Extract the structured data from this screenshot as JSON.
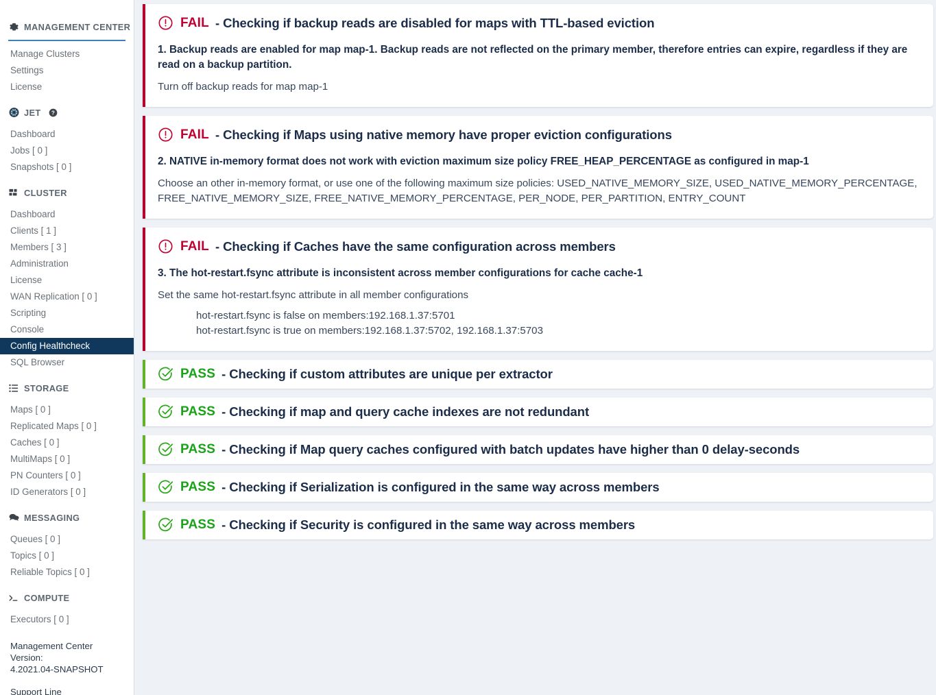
{
  "sidebar": {
    "sections": [
      {
        "id": "management-center",
        "title": "MANAGEMENT CENTER",
        "icon": "gear-icon",
        "underline": true,
        "items": [
          {
            "label": "Manage Clusters",
            "active": false
          },
          {
            "label": "Settings",
            "active": false
          },
          {
            "label": "License",
            "active": false
          }
        ]
      },
      {
        "id": "jet",
        "title": "JET",
        "icon": "jet-icon",
        "help_icon": "help-circle-icon",
        "underline": false,
        "items": [
          {
            "label": "Dashboard",
            "active": false
          },
          {
            "label": "Jobs [ 0 ]",
            "active": false
          },
          {
            "label": "Snapshots [ 0 ]",
            "active": false
          }
        ]
      },
      {
        "id": "cluster",
        "title": "CLUSTER",
        "icon": "grid-icon",
        "underline": false,
        "items": [
          {
            "label": "Dashboard",
            "active": false
          },
          {
            "label": "Clients [ 1 ]",
            "active": false
          },
          {
            "label": "Members [ 3 ]",
            "active": false
          },
          {
            "label": "Administration",
            "active": false
          },
          {
            "label": "License",
            "active": false
          },
          {
            "label": "WAN Replication [ 0 ]",
            "active": false
          },
          {
            "label": "Scripting",
            "active": false
          },
          {
            "label": "Console",
            "active": false
          },
          {
            "label": "Config Healthcheck",
            "active": true
          },
          {
            "label": "SQL Browser",
            "active": false
          }
        ]
      },
      {
        "id": "storage",
        "title": "STORAGE",
        "icon": "list-icon",
        "underline": false,
        "items": [
          {
            "label": "Maps [ 0 ]",
            "active": false
          },
          {
            "label": "Replicated Maps [ 0 ]",
            "active": false
          },
          {
            "label": "Caches [ 0 ]",
            "active": false
          },
          {
            "label": "MultiMaps [ 0 ]",
            "active": false
          },
          {
            "label": "PN Counters [ 0 ]",
            "active": false
          },
          {
            "label": "ID Generators [ 0 ]",
            "active": false
          }
        ]
      },
      {
        "id": "messaging",
        "title": "MESSAGING",
        "icon": "chat-icon",
        "underline": false,
        "items": [
          {
            "label": "Queues [ 0 ]",
            "active": false
          },
          {
            "label": "Topics [ 0 ]",
            "active": false
          },
          {
            "label": "Reliable Topics [ 0 ]",
            "active": false
          }
        ]
      },
      {
        "id": "compute",
        "title": "COMPUTE",
        "icon": "terminal-icon",
        "underline": false,
        "items": [
          {
            "label": "Executors [ 0 ]",
            "active": false
          }
        ]
      }
    ],
    "version_label": "Management Center Version:",
    "version_value": "4.2021.04-SNAPSHOT",
    "support_label": "Support Line"
  },
  "healthcheck": {
    "cards": [
      {
        "status": "FAIL",
        "status_icon": "alert-circle-icon",
        "title": "- Checking if backup reads are disabled for maps with TTL-based eviction",
        "problem": "1. Backup reads are enabled for map map-1. Backup reads are not reflected on the primary member, therefore entries can expire, regardless if they are read on a backup partition.",
        "remedy": "Turn off backup reads for map map-1",
        "details": []
      },
      {
        "status": "FAIL",
        "status_icon": "alert-circle-icon",
        "title": "- Checking if Maps using native memory have proper eviction configurations",
        "problem": "2. NATIVE in-memory format does not work with eviction maximum size policy FREE_HEAP_PERCENTAGE as configured in map-1",
        "remedy": "Choose an other in-memory format, or use one of the following maximum size policies: USED_NATIVE_MEMORY_SIZE, USED_NATIVE_MEMORY_PERCENTAGE, FREE_NATIVE_MEMORY_SIZE, FREE_NATIVE_MEMORY_PERCENTAGE, PER_NODE, PER_PARTITION, ENTRY_COUNT",
        "details": []
      },
      {
        "status": "FAIL",
        "status_icon": "alert-circle-icon",
        "title": "- Checking if Caches have the same configuration across members",
        "problem": "3. The hot-restart.fsync attribute is inconsistent across member configurations for cache cache-1",
        "remedy": "Set the same hot-restart.fsync attribute in all member configurations",
        "details": [
          "hot-restart.fsync is false on members:192.168.1.37:5701",
          "hot-restart.fsync is true on members:192.168.1.37:5702, 192.168.1.37:5703"
        ]
      },
      {
        "status": "PASS",
        "status_icon": "check-circle-icon",
        "title": "- Checking if custom attributes are unique per extractor",
        "problem": "",
        "remedy": "",
        "details": []
      },
      {
        "status": "PASS",
        "status_icon": "check-circle-icon",
        "title": "- Checking if map and query cache indexes are not redundant",
        "problem": "",
        "remedy": "",
        "details": []
      },
      {
        "status": "PASS",
        "status_icon": "check-circle-icon",
        "title": "- Checking if Map query caches configured with batch updates have higher than 0 delay-seconds",
        "problem": "",
        "remedy": "",
        "details": []
      },
      {
        "status": "PASS",
        "status_icon": "check-circle-icon",
        "title": "- Checking if Serialization is configured in the same way across members",
        "problem": "",
        "remedy": "",
        "details": []
      },
      {
        "status": "PASS",
        "status_icon": "check-circle-icon",
        "title": "- Checking if Security is configured in the same way across members",
        "problem": "",
        "remedy": "",
        "details": []
      }
    ]
  },
  "colors": {
    "fail": "#c10230",
    "fail_bar": "#b4002d",
    "pass": "#19a317",
    "pass_bar": "#62b22a",
    "sidebar_active_bg": "#10385c",
    "accent_blue": "#3c7fc4",
    "page_bg": "#eef1f6",
    "title_text": "#1c2d4a"
  }
}
